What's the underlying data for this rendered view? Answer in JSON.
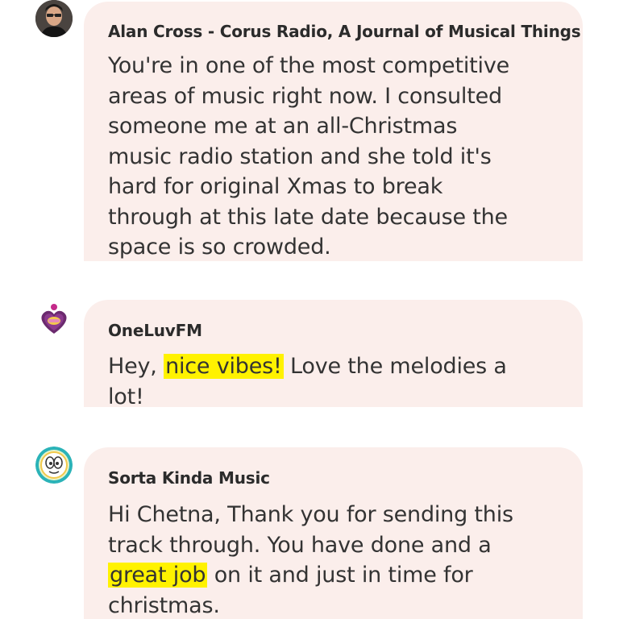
{
  "messages": [
    {
      "sender": "Alan Cross - Corus Radio, A Journal of Musical Things",
      "avatar": "person-photo-avatar",
      "text_lines": [
        "You're in one of the most competitive",
        "areas of music right now. I consulted",
        "someone me at an all-Christmas",
        "music radio station and she told it's",
        "hard for original Xmas to break",
        "through at this late date because the",
        "space is so crowded."
      ]
    },
    {
      "sender": "OneLuvFM",
      "avatar": "oneluvfm-logo-avatar",
      "text_before": "Hey, ",
      "highlight": "nice vibes!",
      "text_after": " Love the melodies a",
      "text_line2": "lot!"
    },
    {
      "sender": "Sorta Kinda Music",
      "avatar": "sorta-kinda-music-logo-avatar",
      "text_line1": "Hi Chetna, Thank you for sending this",
      "text_line2": "track through. You have done and a",
      "highlight": "great job",
      "text_after": " on it and just in time for",
      "text_line4": "christmas."
    }
  ],
  "colors": {
    "bubble": "#fbeeeb",
    "highlight": "#fff200",
    "text": "#333333"
  }
}
